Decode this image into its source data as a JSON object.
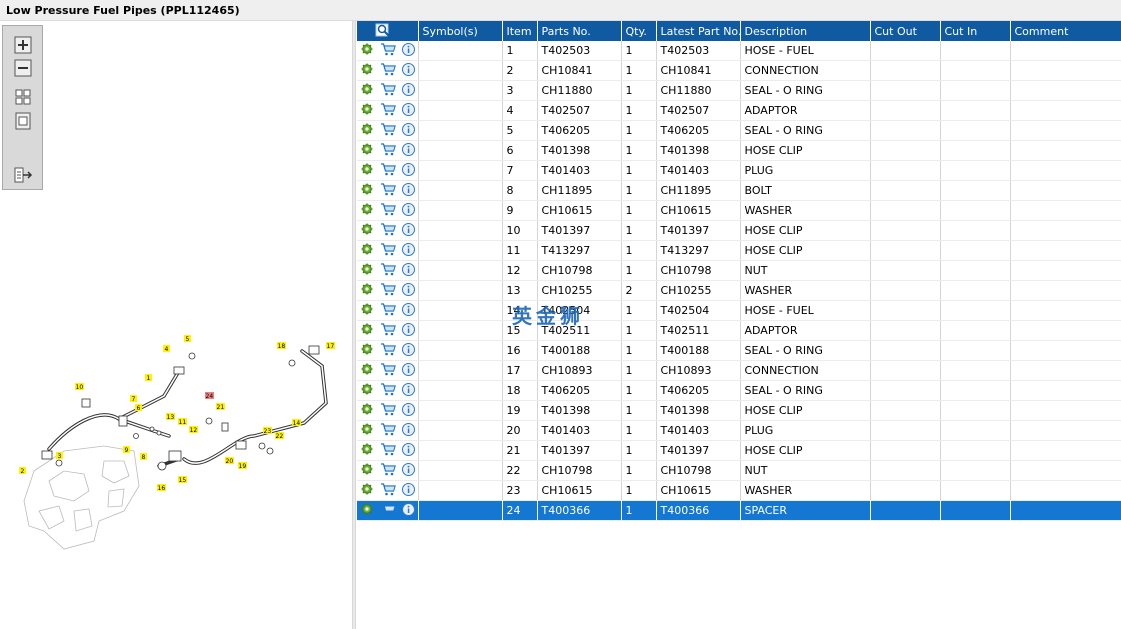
{
  "window": {
    "title": "Low Pressure Fuel Pipes (PPL112465)"
  },
  "toolbar": {
    "buttons": [
      {
        "name": "zoom-in-button",
        "icon": "zoom-in-icon"
      },
      {
        "name": "zoom-out-button",
        "icon": "zoom-out-icon"
      },
      {
        "name": "fit-all-button",
        "icon": "fit-icon"
      },
      {
        "name": "actual-size-button",
        "icon": "actual-size-icon"
      },
      {
        "name": "export-button",
        "icon": "export-icon"
      }
    ]
  },
  "table": {
    "headers": [
      "",
      "Symbol(s)",
      "Item",
      "Parts No.",
      "Qty.",
      "Latest Part No.",
      "Description",
      "Cut Out",
      "Cut In",
      "Comment"
    ],
    "rows": [
      {
        "item": "1",
        "part": "T402503",
        "qty": "1",
        "latest": "T402503",
        "desc": "HOSE - FUEL"
      },
      {
        "item": "2",
        "part": "CH10841",
        "qty": "1",
        "latest": "CH10841",
        "desc": "CONNECTION"
      },
      {
        "item": "3",
        "part": "CH11880",
        "qty": "1",
        "latest": "CH11880",
        "desc": "SEAL - O RING"
      },
      {
        "item": "4",
        "part": "T402507",
        "qty": "1",
        "latest": "T402507",
        "desc": "ADAPTOR"
      },
      {
        "item": "5",
        "part": "T406205",
        "qty": "1",
        "latest": "T406205",
        "desc": "SEAL - O RING"
      },
      {
        "item": "6",
        "part": "T401398",
        "qty": "1",
        "latest": "T401398",
        "desc": "HOSE CLIP"
      },
      {
        "item": "7",
        "part": "T401403",
        "qty": "1",
        "latest": "T401403",
        "desc": "PLUG"
      },
      {
        "item": "8",
        "part": "CH11895",
        "qty": "1",
        "latest": "CH11895",
        "desc": "BOLT"
      },
      {
        "item": "9",
        "part": "CH10615",
        "qty": "1",
        "latest": "CH10615",
        "desc": "WASHER"
      },
      {
        "item": "10",
        "part": "T401397",
        "qty": "1",
        "latest": "T401397",
        "desc": "HOSE CLIP"
      },
      {
        "item": "11",
        "part": "T413297",
        "qty": "1",
        "latest": "T413297",
        "desc": "HOSE CLIP"
      },
      {
        "item": "12",
        "part": "CH10798",
        "qty": "1",
        "latest": "CH10798",
        "desc": "NUT"
      },
      {
        "item": "13",
        "part": "CH10255",
        "qty": "2",
        "latest": "CH10255",
        "desc": "WASHER"
      },
      {
        "item": "14",
        "part": "T402504",
        "qty": "1",
        "latest": "T402504",
        "desc": "HOSE - FUEL"
      },
      {
        "item": "15",
        "part": "T402511",
        "qty": "1",
        "latest": "T402511",
        "desc": "ADAPTOR"
      },
      {
        "item": "16",
        "part": "T400188",
        "qty": "1",
        "latest": "T400188",
        "desc": "SEAL - O RING"
      },
      {
        "item": "17",
        "part": "CH10893",
        "qty": "1",
        "latest": "CH10893",
        "desc": "CONNECTION"
      },
      {
        "item": "18",
        "part": "T406205",
        "qty": "1",
        "latest": "T406205",
        "desc": "SEAL - O RING"
      },
      {
        "item": "19",
        "part": "T401398",
        "qty": "1",
        "latest": "T401398",
        "desc": "HOSE CLIP"
      },
      {
        "item": "20",
        "part": "T401403",
        "qty": "1",
        "latest": "T401403",
        "desc": "PLUG"
      },
      {
        "item": "21",
        "part": "T401397",
        "qty": "1",
        "latest": "T401397",
        "desc": "HOSE CLIP"
      },
      {
        "item": "22",
        "part": "CH10798",
        "qty": "1",
        "latest": "CH10798",
        "desc": "NUT"
      },
      {
        "item": "23",
        "part": "CH10615",
        "qty": "1",
        "latest": "CH10615",
        "desc": "WASHER"
      },
      {
        "item": "24",
        "part": "T400366",
        "qty": "1",
        "latest": "T400366",
        "desc": "SPACER"
      }
    ],
    "selected_item": "24"
  },
  "diagram": {
    "callouts": [
      "1",
      "2",
      "3",
      "4",
      "5",
      "6",
      "7",
      "8",
      "9",
      "10",
      "11",
      "12",
      "13",
      "14",
      "15",
      "16",
      "17",
      "18",
      "19",
      "20",
      "21",
      "22",
      "23",
      "24"
    ],
    "highlighted_callout": "24"
  },
  "watermark": {
    "text": "英金狮"
  },
  "colors": {
    "header": "#0f5aa0",
    "selected": "#1478d2",
    "callout": "#fff200",
    "callout_selected": "#f08080"
  }
}
